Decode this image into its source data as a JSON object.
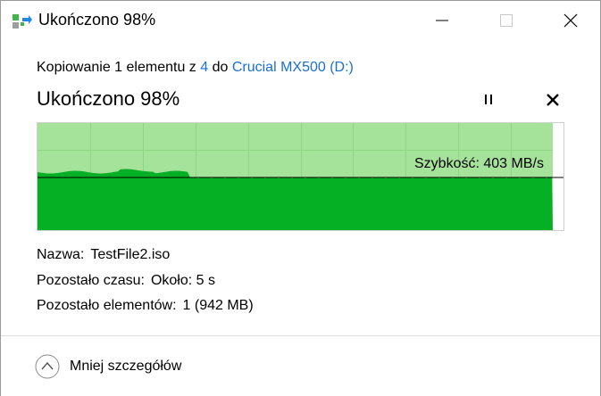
{
  "window": {
    "title": "Ukończono 98%",
    "icon": "copy-progress-icon",
    "controls": {
      "minimize": "minimize-icon",
      "maximize": "maximize-icon",
      "close": "close-icon"
    }
  },
  "copy": {
    "prefix": "Kopiowanie 1 elementu z ",
    "source": "4",
    "middle": " do ",
    "destination": "Crucial MX500 (D:)"
  },
  "progress": {
    "title": "Ukończono 98%",
    "percent": 98,
    "pause_icon": "pause-icon",
    "stop_icon": "stop-icon"
  },
  "graph": {
    "speed_label": "Szybkość: 403 MB/s",
    "speed_mbs": 403,
    "colors": {
      "done": "#a6e39a",
      "fill": "#06b025",
      "grid": "#8fd583",
      "line": "#000000"
    }
  },
  "details": {
    "name_label": "Nazwa:",
    "name_value": "TestFile2.iso",
    "time_label": "Pozostało czasu:",
    "time_value": "Około: 5 s",
    "items_label": "Pozostało elementów:",
    "items_value": "1 (942 MB)"
  },
  "footer": {
    "toggle_label": "Mniej szczegółów",
    "toggle_icon": "chevron-up-circle-icon"
  }
}
